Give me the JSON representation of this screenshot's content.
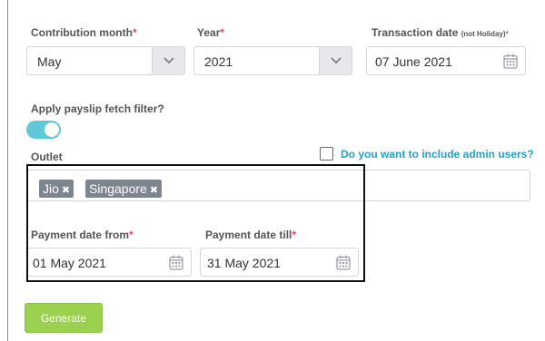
{
  "contribution_month": {
    "label": "Contribution month",
    "required_mark": "*",
    "value": "May",
    "icon": "chevron-down-icon"
  },
  "year": {
    "label": "Year",
    "required_mark": "*",
    "value": "2021",
    "icon": "chevron-down-icon"
  },
  "transaction_date": {
    "label": "Transaction date",
    "note": "(not Holiday)",
    "required_mark": "*",
    "value": "07 June 2021",
    "icon": "calendar-icon"
  },
  "payslip_filter": {
    "label": "Apply payslip fetch filter?",
    "enabled": true
  },
  "outlet": {
    "label": "Outlet",
    "tags": [
      {
        "label": "Jio",
        "remove_icon": "✖"
      },
      {
        "label": "Singapore",
        "remove_icon": "✖"
      }
    ]
  },
  "admin_users": {
    "label": "Do you want to include admin users?",
    "checked": false
  },
  "payment_date_from": {
    "label": "Payment date from",
    "required_mark": "*",
    "value": "01 May 2021",
    "icon": "calendar-icon"
  },
  "payment_date_till": {
    "label": "Payment date till",
    "required_mark": "*",
    "value": "31 May 2021",
    "icon": "calendar-icon"
  },
  "generate_button": {
    "label": "Generate"
  },
  "colors": {
    "accent_cyan": "#5ec9d8",
    "link_blue": "#2b9fc4",
    "required_pink": "#e0457b",
    "button_green": "#9bd14f",
    "tag_gray": "#7d8591"
  }
}
